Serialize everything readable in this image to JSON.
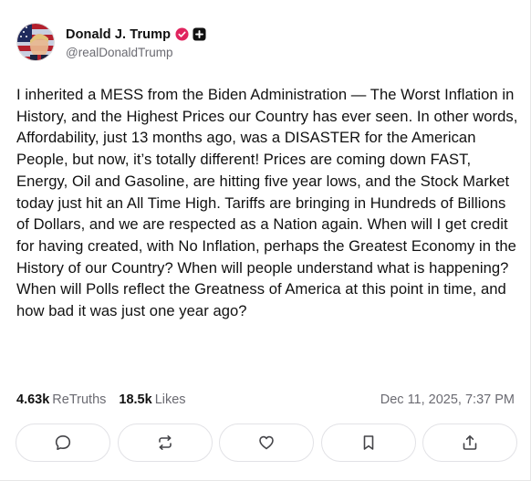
{
  "author": {
    "display_name": "Donald J. Trump",
    "handle": "@realDonaldTrump",
    "verified_icon": "verified-badge-icon",
    "badge_icon": "plus-badge-icon",
    "verified_color": "#e0245e"
  },
  "post": {
    "text": "I inherited a MESS from the Biden Administration — The Worst Inflation in History, and the Highest Prices our Country has ever seen. In other words, Affordability, just 13 months ago, was a DISASTER for the American People, but now, it’s totally different! Prices are coming down FAST, Energy, Oil and Gasoline, are hitting five year lows, and the Stock Market today just hit an All Time High. Tariffs are bringing in Hundreds of Billions of Dollars, and we are respected as a Nation again. When will I get credit for having created, with No Inflation, perhaps the Greatest Economy in the History of our Country? When will people understand what is happening? When will Polls reflect the Greatness of America at this point in time, and how bad it was just one year ago?"
  },
  "stats": {
    "retruths_count": "4.63k",
    "retruths_label": "ReTruths",
    "likes_count": "18.5k",
    "likes_label": "Likes",
    "timestamp": "Dec 11, 2025, 7:37 PM"
  },
  "actions": [
    {
      "name": "reply",
      "icon": "comment-icon"
    },
    {
      "name": "retruth",
      "icon": "repost-icon"
    },
    {
      "name": "like",
      "icon": "heart-icon"
    },
    {
      "name": "bookmark",
      "icon": "bookmark-icon"
    },
    {
      "name": "share",
      "icon": "share-icon"
    }
  ]
}
